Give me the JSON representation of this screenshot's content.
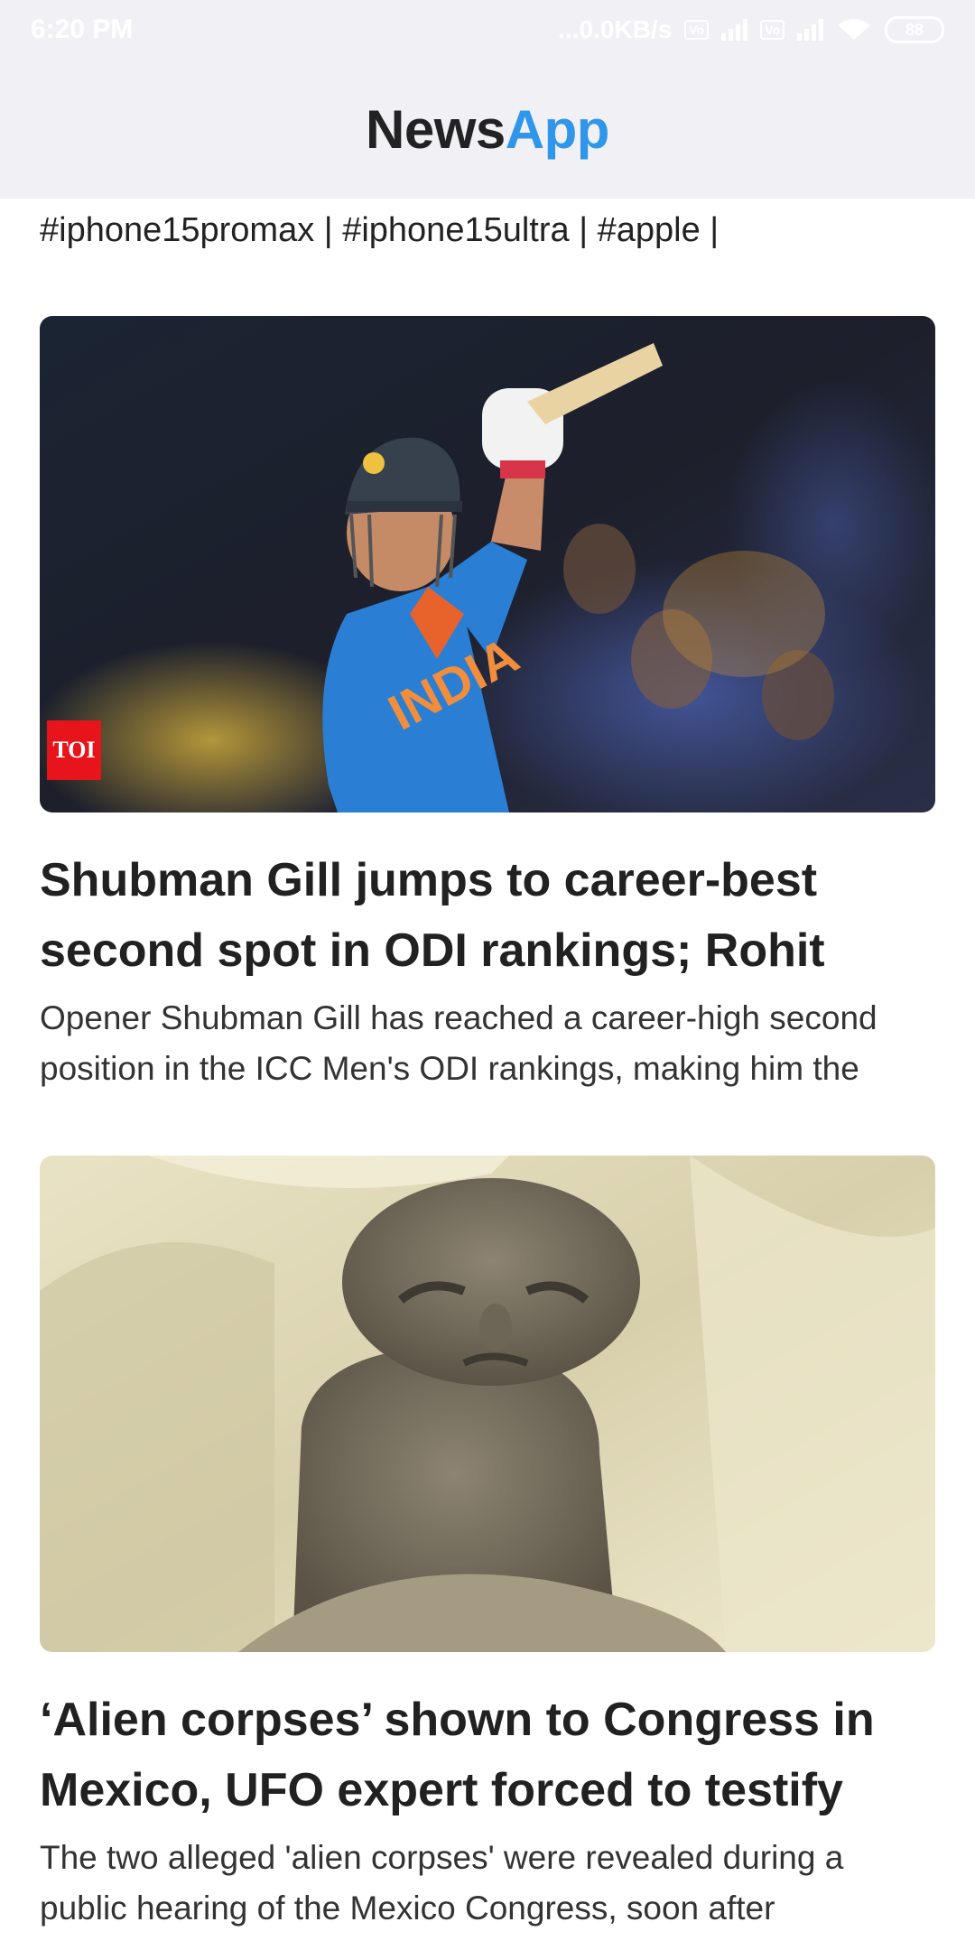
{
  "status_bar": {
    "time": "6:20 PM",
    "network_speed": "...0.0KB/s",
    "volte1": "Vo",
    "volte2": "Vo",
    "battery": "88"
  },
  "app_bar": {
    "brand_part1": "News",
    "brand_part2": "App"
  },
  "feed": {
    "hashtags_line": "#iphone15promax | #iphone15ultra | #apple |",
    "articles": [
      {
        "title": "Shubman Gill jumps to career-best second spot in ODI rankings; Rohit",
        "description": "Opener Shubman Gill has reached a career-high second position in the ICC Men's ODI rankings, making him the",
        "image_badge": "TOI",
        "jersey_text": "INDIA"
      },
      {
        "title": "‘Alien corpses’ shown to Congress in Mexico, UFO expert forced to testify",
        "description": "The two alleged 'alien corpses' were revealed during a public hearing of the Mexico Congress, soon after"
      }
    ]
  },
  "colors": {
    "app_bar_bg": "#f1f1f5",
    "brand_dark": "#222222",
    "brand_accent": "#2f96ea",
    "toi_red": "#e8141c"
  }
}
